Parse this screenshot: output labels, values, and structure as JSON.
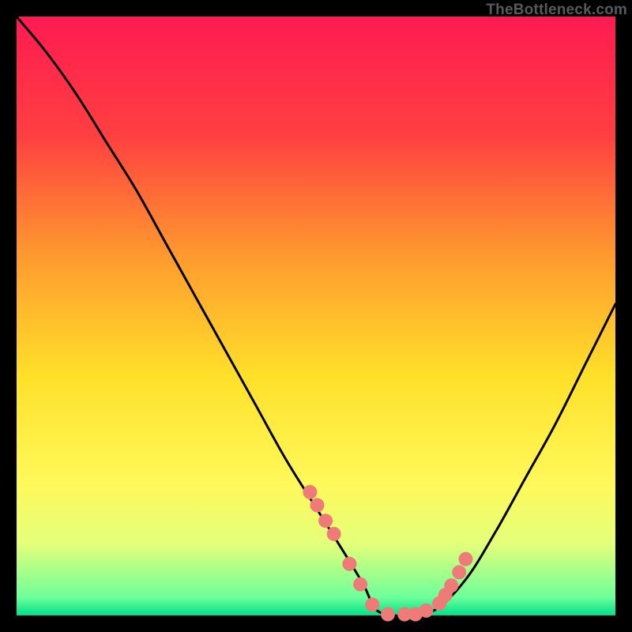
{
  "watermark": "TheBottleneck.com",
  "chart_data": {
    "type": "line",
    "title": "",
    "xlabel": "",
    "ylabel": "",
    "xlim": [
      0,
      100
    ],
    "ylim": [
      0,
      100
    ],
    "gradient_stops": [
      {
        "pct": 0,
        "color": "#ff1a52"
      },
      {
        "pct": 20,
        "color": "#ff4040"
      },
      {
        "pct": 40,
        "color": "#ff9a2e"
      },
      {
        "pct": 60,
        "color": "#ffe02a"
      },
      {
        "pct": 78,
        "color": "#fff95a"
      },
      {
        "pct": 88,
        "color": "#e4ff7a"
      },
      {
        "pct": 97,
        "color": "#6dff9a"
      },
      {
        "pct": 100,
        "color": "#00e08a"
      }
    ],
    "series": [
      {
        "name": "bottleneck-curve",
        "x": [
          0,
          5,
          10,
          15,
          20,
          25,
          30,
          35,
          40,
          45,
          50,
          55,
          58,
          60,
          63,
          66,
          70,
          75,
          80,
          85,
          90,
          95,
          100
        ],
        "y": [
          100,
          94,
          87,
          79,
          71,
          62,
          53,
          44,
          35,
          26,
          18,
          10,
          5,
          1,
          0,
          0,
          1,
          6,
          14,
          23,
          32,
          42,
          52
        ]
      }
    ],
    "markers": {
      "name": "highlight-dots",
      "color": "#ef7b78",
      "radius": 9,
      "x": [
        49.0,
        50.2,
        51.6,
        53.0,
        55.6,
        57.4,
        59.4,
        62.0,
        64.8,
        66.6,
        68.4,
        70.6,
        71.6,
        72.6,
        73.9,
        75.0
      ],
      "y": [
        20.6,
        18.4,
        15.8,
        13.6,
        8.6,
        5.2,
        1.8,
        0.2,
        0.2,
        0.2,
        0.8,
        2.0,
        3.4,
        5.0,
        7.2,
        9.4
      ]
    }
  }
}
